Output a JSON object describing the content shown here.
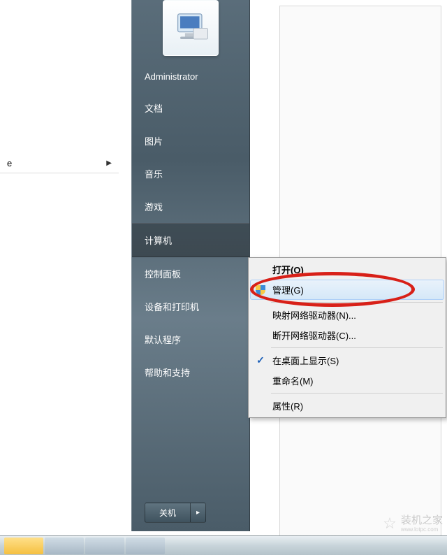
{
  "left_panel": {
    "item_label": "e"
  },
  "start_menu": {
    "user": "Administrator",
    "items": [
      {
        "label": "文档"
      },
      {
        "label": "图片"
      },
      {
        "label": "音乐"
      },
      {
        "label": "游戏"
      },
      {
        "label": "计算机",
        "selected": true
      },
      {
        "label": "控制面板"
      },
      {
        "label": "设备和打印机"
      },
      {
        "label": "默认程序"
      },
      {
        "label": "帮助和支持"
      }
    ],
    "shutdown": "关机"
  },
  "context_menu": {
    "open": "打开(O)",
    "manage": "管理(G)",
    "map_drive": "映射网络驱动器(N)...",
    "disconnect_drive": "断开网络驱动器(C)...",
    "show_desktop": "在桌面上显示(S)",
    "rename": "重命名(M)",
    "properties": "属性(R)"
  },
  "watermark": {
    "text": "装机之家",
    "url": "www.lotpc.com"
  }
}
